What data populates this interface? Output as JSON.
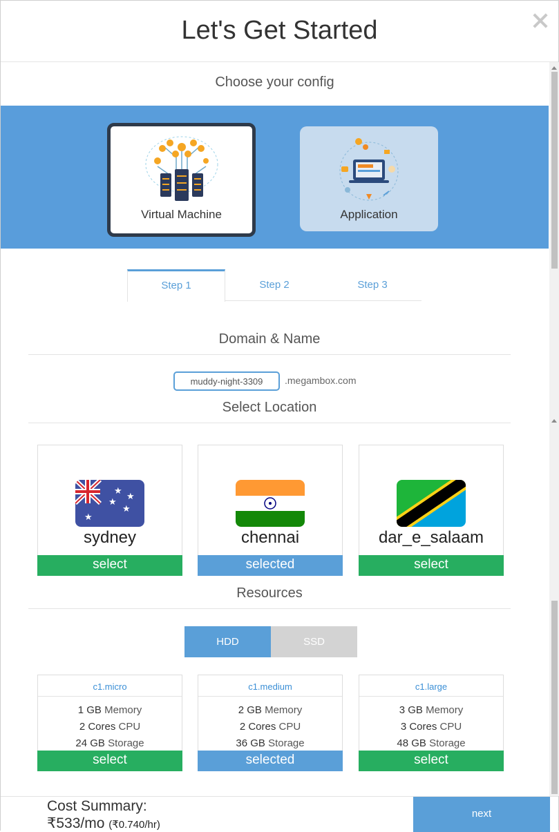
{
  "modal": {
    "title": "Let's Get Started"
  },
  "config": {
    "heading": "Choose your config",
    "options": [
      {
        "label": "Virtual Machine",
        "selected": true
      },
      {
        "label": "Application",
        "selected": false
      }
    ]
  },
  "steps": [
    "Step 1",
    "Step 2",
    "Step 3"
  ],
  "domain": {
    "heading": "Domain & Name",
    "value": "muddy-night-3309",
    "suffix": ".megambox.com"
  },
  "location": {
    "heading": "Select Location",
    "items": [
      {
        "name": "sydney",
        "button": "select",
        "selected": false
      },
      {
        "name": "chennai",
        "button": "selected",
        "selected": true
      },
      {
        "name": "dar_e_salaam",
        "button": "select",
        "selected": false
      }
    ]
  },
  "resources": {
    "heading": "Resources",
    "disk_options": [
      "HDD",
      "SSD"
    ],
    "plans": [
      {
        "name": "c1.micro",
        "memory": "1 GB",
        "memory_unit": "Memory",
        "cpu": "2 Cores",
        "cpu_unit": "CPU",
        "storage": "24 GB",
        "storage_unit": "Storage",
        "button": "select"
      },
      {
        "name": "c1.medium",
        "memory": "2 GB",
        "memory_unit": "Memory",
        "cpu": "2 Cores",
        "cpu_unit": "CPU",
        "storage": "36 GB",
        "storage_unit": "Storage",
        "button": "selected"
      },
      {
        "name": "c1.large",
        "memory": "3 GB",
        "memory_unit": "Memory",
        "cpu": "3 Cores",
        "cpu_unit": "CPU",
        "storage": "48 GB",
        "storage_unit": "Storage",
        "button": "select"
      }
    ]
  },
  "footer": {
    "cost_label": "Cost Summary:",
    "monthly": "₹533/mo",
    "hourly": "(₹0.740/hr)",
    "next_label": "next"
  },
  "colors": {
    "accent": "#5a9fd8",
    "select_green": "#27ae60",
    "band": "#599ddb"
  }
}
